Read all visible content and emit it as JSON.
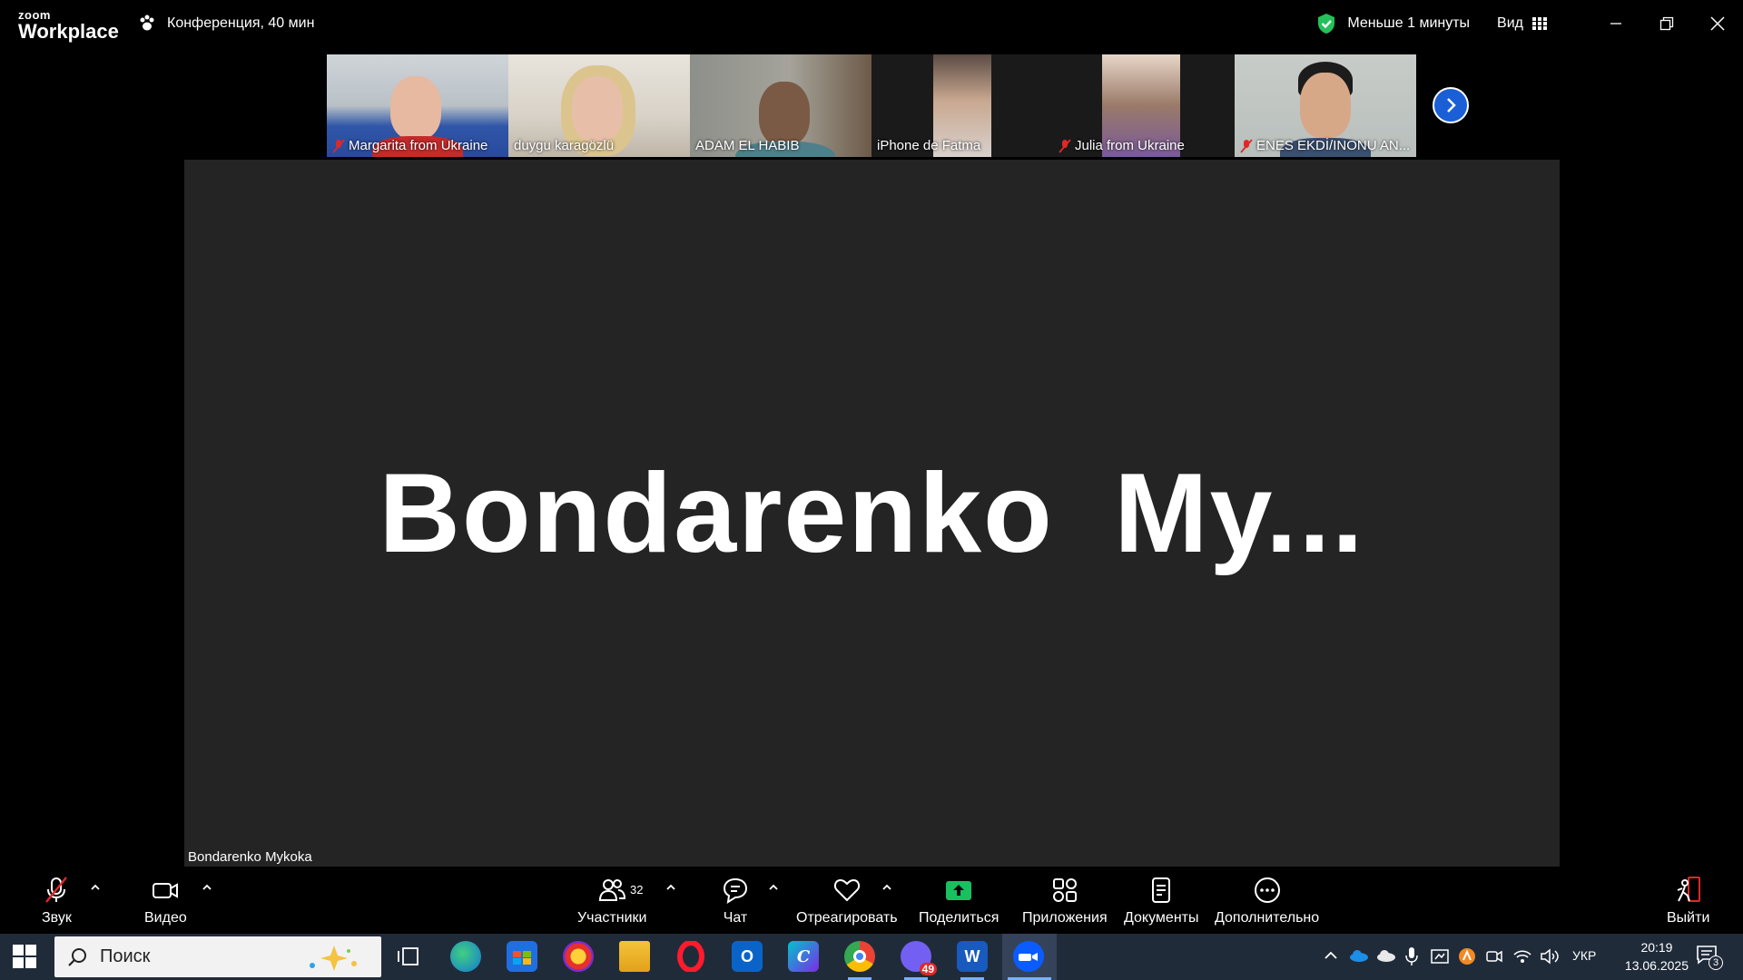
{
  "app": {
    "logo_small": "zoom",
    "logo_big": "Workplace"
  },
  "meeting": {
    "title": "Конференция, 40 мин"
  },
  "top_right": {
    "timer": "Меньше 1 минуты",
    "view": "Вид"
  },
  "thumbnails": [
    {
      "name": "Margarita from  Ukraine",
      "muted": true
    },
    {
      "name": "duygu karagözlü",
      "muted": false
    },
    {
      "name": "ADAM EL HABIB",
      "muted": false
    },
    {
      "name": "iPhone de Fatma",
      "muted": false
    },
    {
      "name": "Julia from Ukraine",
      "muted": true
    },
    {
      "name": "ENES EKDİ/INONU AN...",
      "muted": true
    }
  ],
  "stage": {
    "big_name": "Bondarenko  My...",
    "label": "Bondarenko Mykoka"
  },
  "toolbar": {
    "audio": "Звук",
    "video": "Видео",
    "participants": "Участники",
    "participants_count": "32",
    "chat": "Чат",
    "react": "Отреагировать",
    "share": "Поделиться",
    "apps": "Приложения",
    "docs": "Документы",
    "more": "Дополнительно",
    "leave": "Выйти"
  },
  "taskbar": {
    "search_placeholder": "Поиск",
    "viber_badge": "49",
    "language": "УКР",
    "time": "20:19",
    "date": "13.06.2025",
    "notifications": "3"
  },
  "colors": {
    "stage": "#242424",
    "accent": "#1a5fd6",
    "share": "#19c060",
    "taskbar": "#202b3a"
  }
}
